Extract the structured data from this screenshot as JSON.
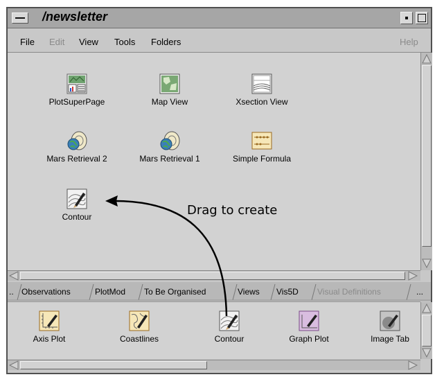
{
  "window": {
    "title": "/newsletter"
  },
  "menubar": {
    "items": [
      "File",
      "Edit",
      "View",
      "Tools",
      "Folders"
    ],
    "help": "Help"
  },
  "folder_icons": [
    {
      "label": "PlotSuperPage",
      "icon": "plot-superpage-icon"
    },
    {
      "label": "Map View",
      "icon": "map-view-icon"
    },
    {
      "label": "Xsection View",
      "icon": "xsection-view-icon"
    },
    {
      "label": "Mars Retrieval 2",
      "icon": "mars-retrieval-icon"
    },
    {
      "label": "Mars Retrieval 1",
      "icon": "mars-retrieval-icon"
    },
    {
      "label": "Simple Formula",
      "icon": "simple-formula-icon"
    },
    {
      "label": "Contour",
      "icon": "contour-icon"
    }
  ],
  "annotation": {
    "text": "Drag to create"
  },
  "tabs": [
    {
      "label": "Observations"
    },
    {
      "label": "PlotMod"
    },
    {
      "label": "To Be Organised"
    },
    {
      "label": "Views"
    },
    {
      "label": "Vis5D"
    },
    {
      "label": "Visual Definitions",
      "active": true
    },
    {
      "label": "..."
    }
  ],
  "tabs_left_overflow": "..",
  "palette_icons": [
    {
      "label": "Axis Plot",
      "icon": "axis-plot-icon"
    },
    {
      "label": "Coastlines",
      "icon": "coastlines-icon"
    },
    {
      "label": "Contour",
      "icon": "contour-icon"
    },
    {
      "label": "Graph Plot",
      "icon": "graph-plot-icon"
    },
    {
      "label": "Image Tab",
      "icon": "image-tab-icon"
    }
  ]
}
